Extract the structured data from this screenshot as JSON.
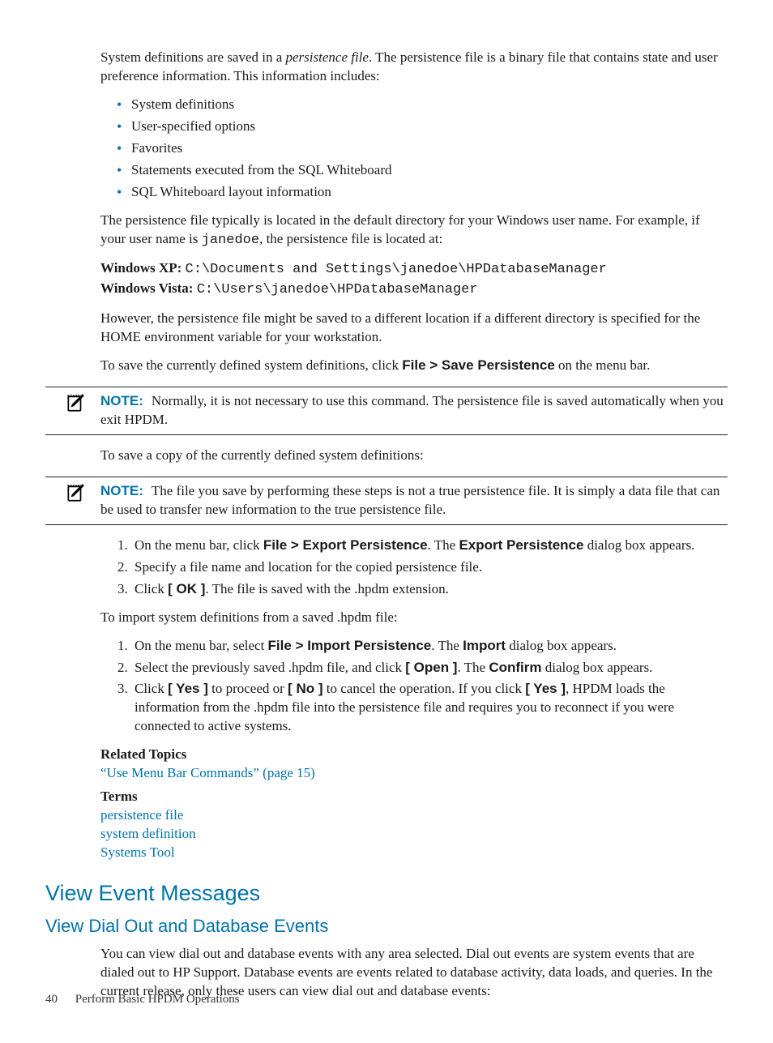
{
  "intro": {
    "p1a": "System definitions are saved in a ",
    "p1b": "persistence file",
    "p1c": ". The persistence file is a binary file that contains state and user preference information. This information includes:",
    "bullets": [
      "System definitions",
      "User-specified options",
      "Favorites",
      "Statements executed from the SQL Whiteboard",
      "SQL Whiteboard layout information"
    ],
    "p2a": "The persistence file typically is located in the default directory for your Windows user name. For example, if your user name is ",
    "p2b": "janedoe",
    "p2c": ", the persistence file is located at:",
    "xp_label": "Windows XP: ",
    "xp_path": "C:\\Documents and Settings\\janedoe\\HPDatabaseManager",
    "vista_label": "Windows Vista: ",
    "vista_path": "C:\\Users\\janedoe\\HPDatabaseManager",
    "p3": "However, the persistence file might be saved to a different location if a different directory is specified for the HOME environment variable for your workstation.",
    "p4a": "To save the currently defined system definitions, click ",
    "p4b": "File > Save Persistence",
    "p4c": " on the menu bar."
  },
  "note1": {
    "label": "NOTE:",
    "text": "Normally, it is not necessary to use this command. The persistence file is saved automatically when you exit HPDM."
  },
  "mid": {
    "p1": "To save a copy of the currently defined system definitions:"
  },
  "note2": {
    "label": "NOTE:",
    "text": "The file you save by performing these steps is not a true persistence file. It is simply a data file that can be used to transfer new information to the true persistence file."
  },
  "steps_export": [
    {
      "a": "On the menu bar, click ",
      "b": "File > Export Persistence",
      "c": ". The ",
      "d": "Export Persistence",
      "e": " dialog box appears."
    },
    {
      "a": "Specify a file name and location for the copied persistence file."
    },
    {
      "a": "Click ",
      "b": "[ OK ]",
      "c": ". The file is saved with the .hpdm extension."
    }
  ],
  "import_intro": "To import system definitions from a saved .hpdm file:",
  "steps_import": [
    {
      "a": "On the menu bar, select ",
      "b": "File > Import Persistence",
      "c": ". The ",
      "d": "Import",
      "e": " dialog box appears."
    },
    {
      "a": "Select the previously saved .hpdm file, and click ",
      "b": "[ Open ]",
      "c": ". The ",
      "d": "Confirm",
      "e": " dialog box appears."
    },
    {
      "a": "Click ",
      "b": "[ Yes ]",
      "c": " to proceed or ",
      "d": "[ No ]",
      "e": " to cancel the operation. If you click ",
      "f": "[ Yes ]",
      "g": ", HPDM loads the information from the .hpdm file into the persistence file and requires you to reconnect if you were connected to active systems."
    }
  ],
  "related": {
    "head": "Related Topics",
    "link1": "“Use Menu Bar Commands” (page 15)",
    "terms_head": "Terms",
    "terms": [
      "persistence file",
      "system definition",
      "Systems Tool"
    ]
  },
  "h2": "View Event Messages",
  "h3": "View Dial Out and Database Events",
  "view_p1": "You can view dial out and database events with any area selected. Dial out events are system events that are dialed out to HP Support. Database events are events related to database activity, data loads, and queries. In the current release, only these users can view dial out and database events:",
  "footer": {
    "page": "40",
    "title": "Perform Basic HPDM Operations"
  }
}
